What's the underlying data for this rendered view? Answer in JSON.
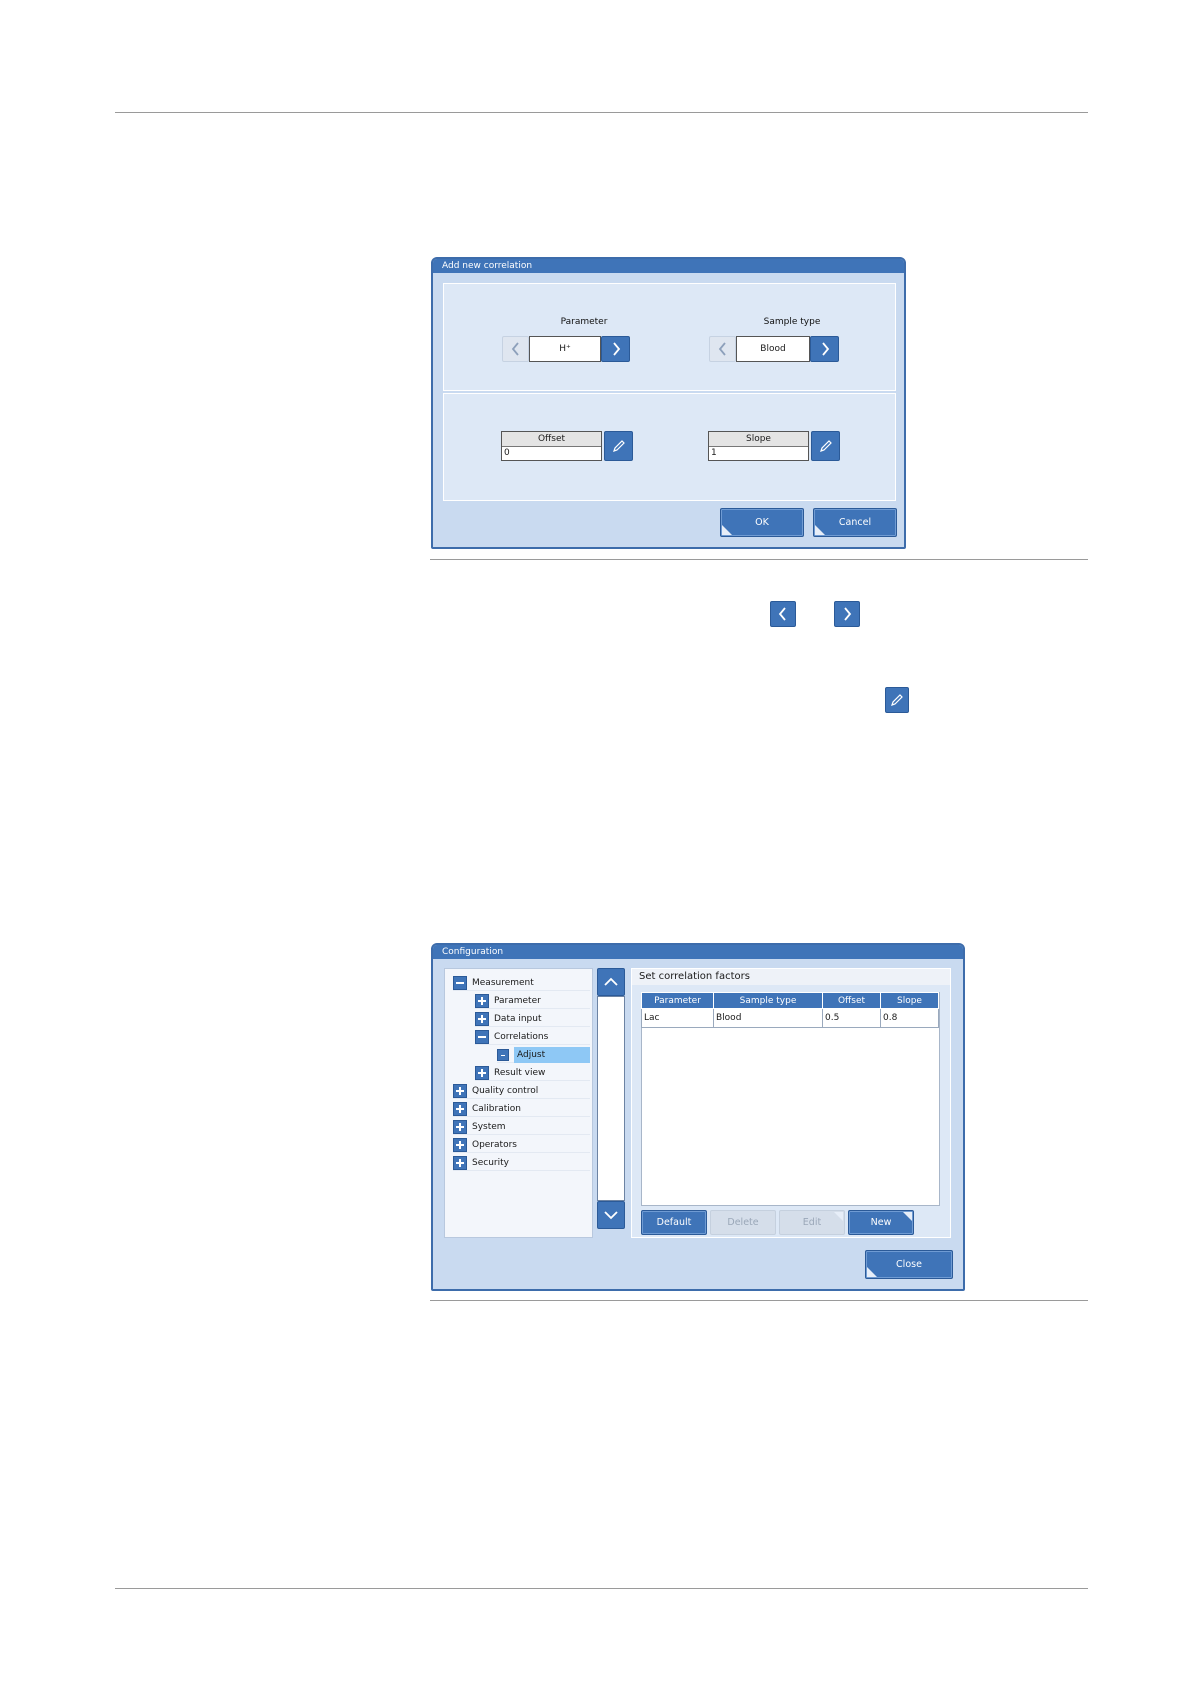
{
  "dialog1": {
    "title": "Add new correlation",
    "parameter_label": "Parameter",
    "parameter_value": "H⁺",
    "sample_type_label": "Sample type",
    "sample_type_value": "Blood",
    "offset_label": "Offset",
    "offset_value": "0",
    "slope_label": "Slope",
    "slope_value": "1",
    "ok_label": "OK",
    "cancel_label": "Cancel"
  },
  "dialog2": {
    "title": "Configuration",
    "panel_title": "Set correlation factors",
    "tree": [
      {
        "label": "Measurement",
        "state": "expanded",
        "level": 0
      },
      {
        "label": "Parameter",
        "state": "collapsed",
        "level": 1
      },
      {
        "label": "Data input",
        "state": "collapsed",
        "level": 1
      },
      {
        "label": "Correlations",
        "state": "expanded",
        "level": 1
      },
      {
        "label": "Adjust",
        "state": "leaf-selected",
        "level": 2
      },
      {
        "label": "Result view",
        "state": "collapsed",
        "level": 1
      },
      {
        "label": "Quality control",
        "state": "collapsed",
        "level": 0
      },
      {
        "label": "Calibration",
        "state": "collapsed",
        "level": 0
      },
      {
        "label": "System",
        "state": "collapsed",
        "level": 0
      },
      {
        "label": "Operators",
        "state": "collapsed",
        "level": 0
      },
      {
        "label": "Security",
        "state": "collapsed",
        "level": 0
      }
    ],
    "table": {
      "headers": [
        "Parameter",
        "Sample type",
        "Offset",
        "Slope"
      ],
      "rows": [
        [
          "Lac",
          "Blood",
          "0.5",
          "0.8"
        ]
      ]
    },
    "buttons": {
      "default": "Default",
      "delete": "Delete",
      "edit": "Edit",
      "new": "New",
      "close": "Close"
    }
  },
  "colors": {
    "accent": "#3f74b8",
    "window_bg": "#c9daf0",
    "selected": "#8ec8f5"
  }
}
